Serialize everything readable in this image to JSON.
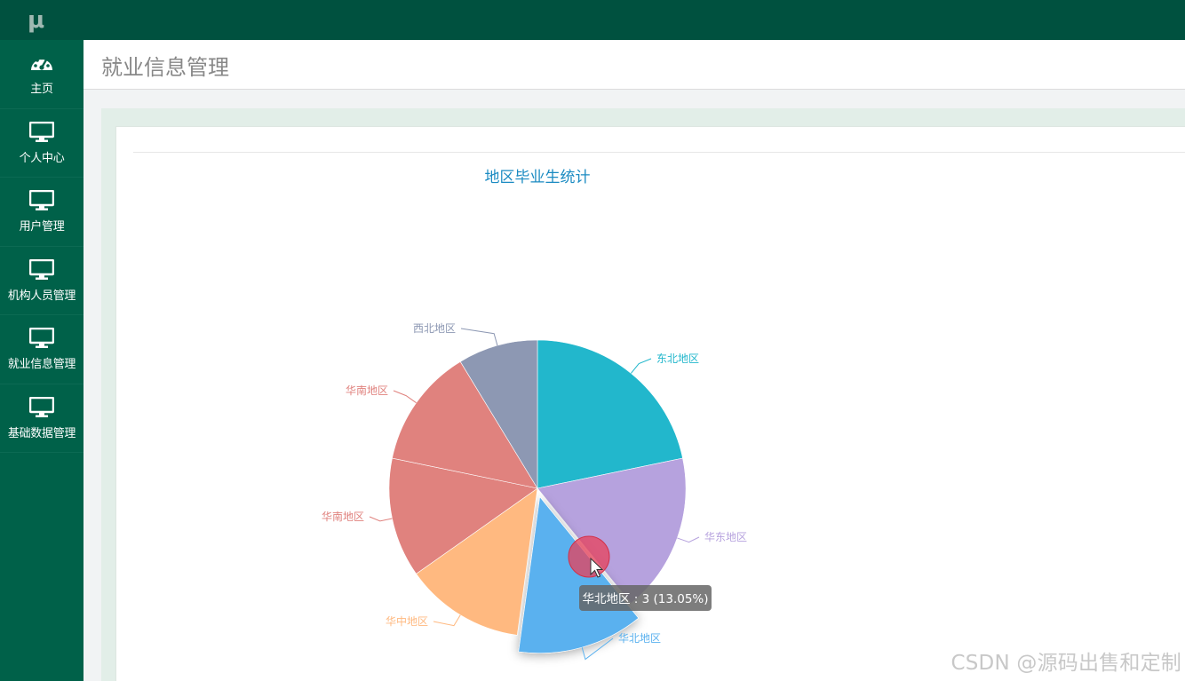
{
  "app": {
    "logo": "μ"
  },
  "sidebar": {
    "items": [
      {
        "label": "主页",
        "icon": "dashboard-icon"
      },
      {
        "label": "个人中心",
        "icon": "monitor-icon"
      },
      {
        "label": "用户管理",
        "icon": "monitor-icon"
      },
      {
        "label": "机构人员管理",
        "icon": "monitor-icon"
      },
      {
        "label": "就业信息管理",
        "icon": "monitor-icon"
      },
      {
        "label": "基础数据管理",
        "icon": "monitor-icon"
      }
    ]
  },
  "header": {
    "title": "就业信息管理"
  },
  "chart_data": {
    "type": "pie",
    "title": "地区毕业生统计",
    "categories": [
      "东北地区",
      "华东地区",
      "华北地区",
      "华中地区",
      "华南地区",
      "华南地区",
      "西北地区"
    ],
    "values": [
      5,
      4,
      3,
      3,
      3,
      3,
      2
    ],
    "colors": [
      "#22b7cc",
      "#b6a2de",
      "#5ab1ef",
      "#ffb980",
      "#e0827e",
      "#e0827e",
      "#8d98b3"
    ],
    "highlighted": "华北地区",
    "tooltip": "华北地区 : 3 (13.05%)"
  },
  "watermark": "CSDN @源码出售和定制",
  "colors": {
    "sidebar": "#006149",
    "topbar": "#00513f",
    "accent": "#1b8bc2"
  }
}
